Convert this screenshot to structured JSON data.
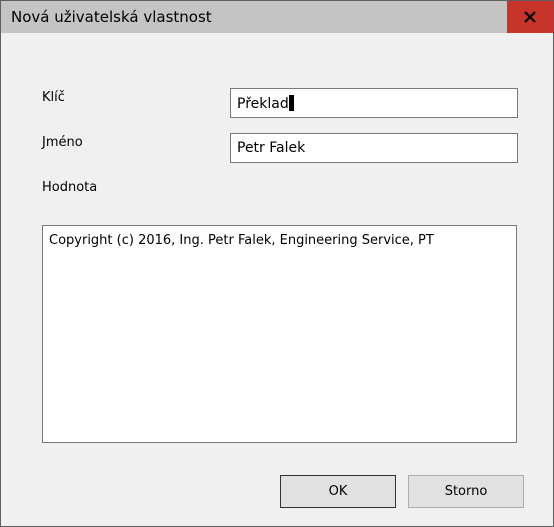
{
  "dialog": {
    "title": "Nová uživatelská vlastnost",
    "close_icon": "close-icon"
  },
  "form": {
    "key_label": "Klíč",
    "key_value": "Překlad",
    "name_label": "Jméno",
    "name_value": "Petr Falek",
    "value_label": "Hodnota",
    "value_text": "Copyright (c) 2016, Ing. Petr Falek, Engineering Service, PT"
  },
  "buttons": {
    "ok_label": "OK",
    "cancel_label": "Storno"
  }
}
